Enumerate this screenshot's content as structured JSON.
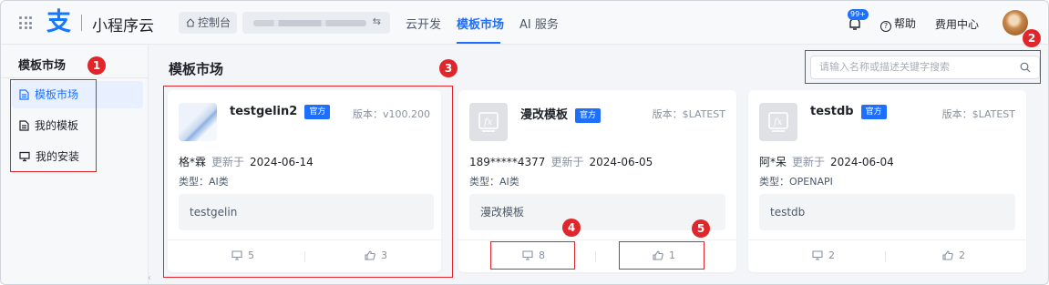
{
  "header": {
    "brand": "小程序云",
    "console_label": "控制台",
    "app_switch_icon": "swap-icon",
    "nav": [
      "云开发",
      "模板市场",
      "AI 服务"
    ],
    "active_nav_index": 1,
    "notification_badge": "99+",
    "help_label": "帮助",
    "fee_label": "费用中心"
  },
  "sidebar": {
    "title": "模板市场",
    "items": [
      {
        "label": "模板市场",
        "icon": "file-icon",
        "active": true
      },
      {
        "label": "我的模板",
        "icon": "document-icon",
        "active": false
      },
      {
        "label": "我的安装",
        "icon": "monitor-icon",
        "active": false
      }
    ]
  },
  "main": {
    "title": "模板市场",
    "search_placeholder": "请输入名称或描述关键字搜索"
  },
  "cards": [
    {
      "name": "testgelin2",
      "tag": "官方",
      "version": "版本：v100.200",
      "author": "格*霖",
      "updated_label": "更新于",
      "date": "2024-06-14",
      "type": "类型：AI类",
      "description": "testgelin",
      "installs": "5",
      "likes": "3"
    },
    {
      "name": "漫改模板",
      "tag": "官方",
      "version": "版本：$LATEST",
      "author": "189*****4377",
      "updated_label": "更新于",
      "date": "2024-06-05",
      "type": "类型：AI类",
      "description": "漫改模板",
      "installs": "8",
      "likes": "1"
    },
    {
      "name": "testdb",
      "tag": "官方",
      "version": "版本：$LATEST",
      "author": "阿*呆",
      "updated_label": "更新于",
      "date": "2024-06-04",
      "type": "类型：OPENAPI",
      "description": "testdb",
      "installs": "2",
      "likes": "2"
    }
  ],
  "annotations": [
    "1",
    "2",
    "3",
    "4",
    "5"
  ],
  "colors": {
    "accent": "#1f6fff",
    "annotation_red": "#e0262b",
    "active_bg": "#e8f0ff"
  }
}
